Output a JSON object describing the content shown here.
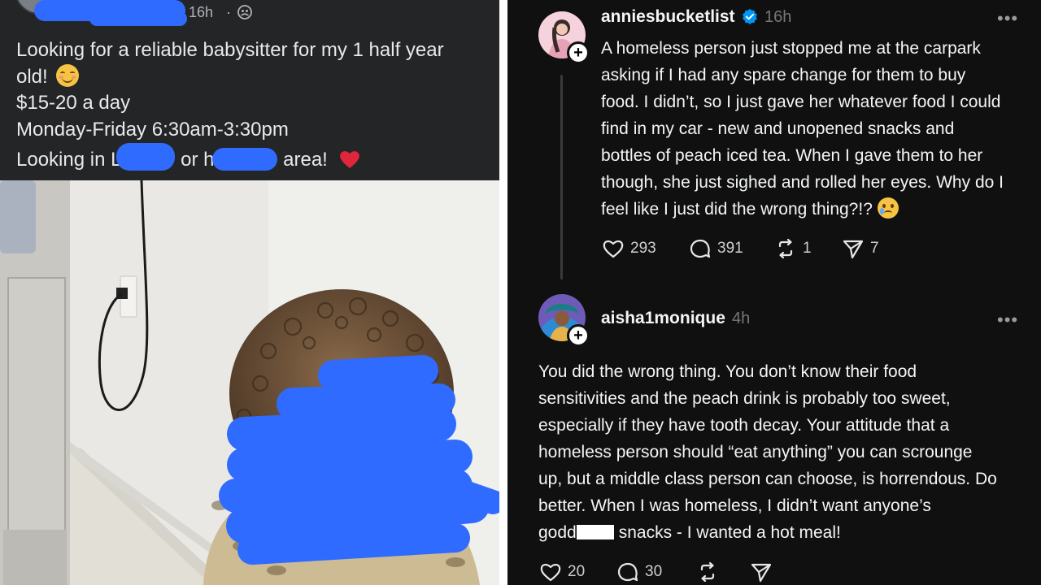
{
  "left_post": {
    "time": "16h",
    "dot": "·",
    "line1": "Looking for a reliable babysitter for my 1 half year",
    "line2": "old!",
    "line3": "$15-20 a day",
    "line4": "Monday-Friday 6:30am-3:30pm",
    "line5_a": "Looking in L",
    "line5_b": "or h",
    "line5_c": "area!"
  },
  "threads_post": {
    "username": "anniesbucketlist",
    "time": "16h",
    "more": "•••",
    "body": [
      "A homeless person just stopped me at the carpark",
      "asking if I had any spare change for them to buy",
      "food. I didn’t, so I just gave her whatever food I could",
      "find in my car - new and unopened snacks and",
      "bottles of peach iced tea. When I gave them to her",
      "though, she just sighed and rolled her eyes. Why do I",
      "feel like I just did the wrong thing?!?"
    ],
    "likes": "293",
    "comments": "391",
    "reposts": "1",
    "shares": "7"
  },
  "threads_reply": {
    "username": "aisha1monique",
    "time": "4h",
    "more": "•••",
    "body": [
      "You did the wrong thing.  You don’t know their food",
      "sensitivities and the peach drink is probably too sweet,",
      "especially if they have tooth decay.  Your attitude that a",
      "homeless person should “eat anything” you can scrounge",
      "up, but a middle class person can choose, is horrendous.  Do",
      "better.  When I was homeless, I didn’t want anyone’s"
    ],
    "last_line_a": "godd",
    "last_line_b": "snacks - I wanted a hot meal!",
    "likes": "20",
    "comments": "30"
  },
  "colors": {
    "facebook_bg": "#242527",
    "threads_bg": "#101010",
    "verified_blue": "#0095f6",
    "redaction_blue": "#2f6bff"
  }
}
